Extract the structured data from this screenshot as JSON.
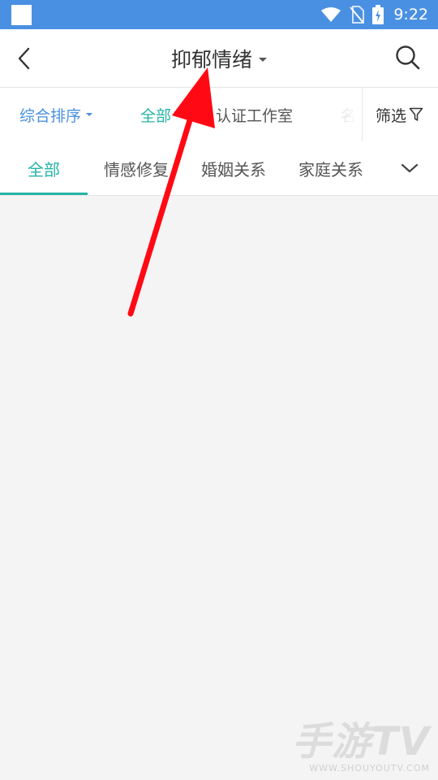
{
  "status_bar": {
    "time": "9:22"
  },
  "header": {
    "title": "抑郁情绪"
  },
  "filter_bar": {
    "sort_label": "综合排序",
    "all_label": "全部",
    "studio_label": "认证工作室",
    "name_label": "名",
    "screen_label": "筛选"
  },
  "tabs": [
    {
      "label": "全部",
      "active": true
    },
    {
      "label": "情感修复"
    },
    {
      "label": "婚姻关系"
    },
    {
      "label": "家庭关系"
    }
  ],
  "watermark": {
    "brand": "手游TV",
    "url": "WWW.SHOUYOUTV.COM"
  },
  "colors": {
    "status_bar": "#4a90e2",
    "accent_teal": "#26b3a6",
    "accent_blue": "#4a90e2",
    "arrow_red": "#ff0a14"
  }
}
